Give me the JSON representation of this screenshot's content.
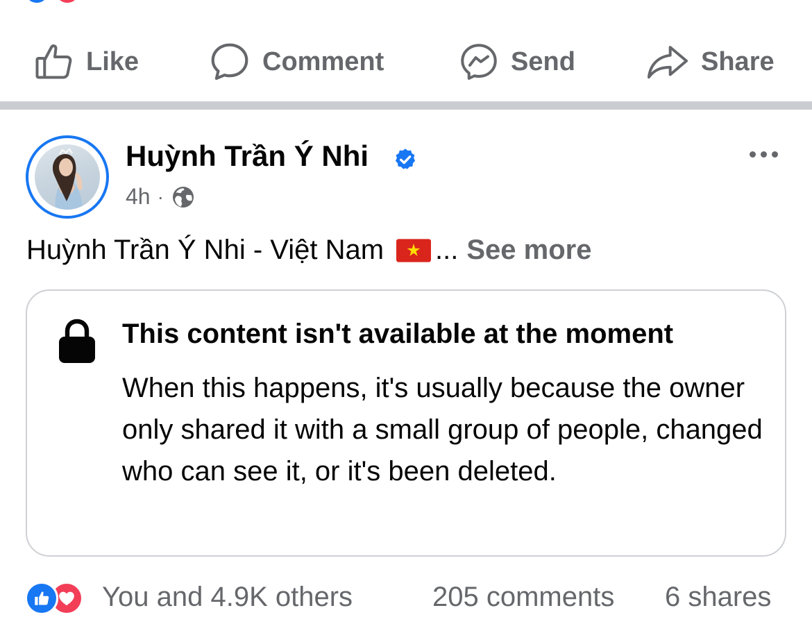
{
  "action_bar": {
    "like_label": "Like",
    "comment_label": "Comment",
    "send_label": "Send",
    "share_label": "Share"
  },
  "post": {
    "author_name": "Huỳnh Trần Ý Nhi",
    "timestamp": "4h",
    "separator": "·",
    "audience_icon": "globe-icon",
    "verified_icon": "verified-badge-icon",
    "text": "Huỳnh Trần Ý Nhi - Việt Nam",
    "flag_icon": "vietnam-flag-icon",
    "ellipsis": "...",
    "see_more_label": "See more"
  },
  "unavailable_card": {
    "title": "This content isn't available at the moment",
    "body": "When this happens, it's usually because the owner only shared it with a small group of people, changed who can see it, or it's been deleted.",
    "icon": "lock-icon"
  },
  "footer": {
    "reactions_text": "You and 4.9K others",
    "comments_text": "205 comments",
    "shares_text": "6 shares"
  },
  "colors": {
    "accent": "#1877f2",
    "secondary_text": "#65676b",
    "love": "#f33e58",
    "divider": "#c9ccd1"
  }
}
